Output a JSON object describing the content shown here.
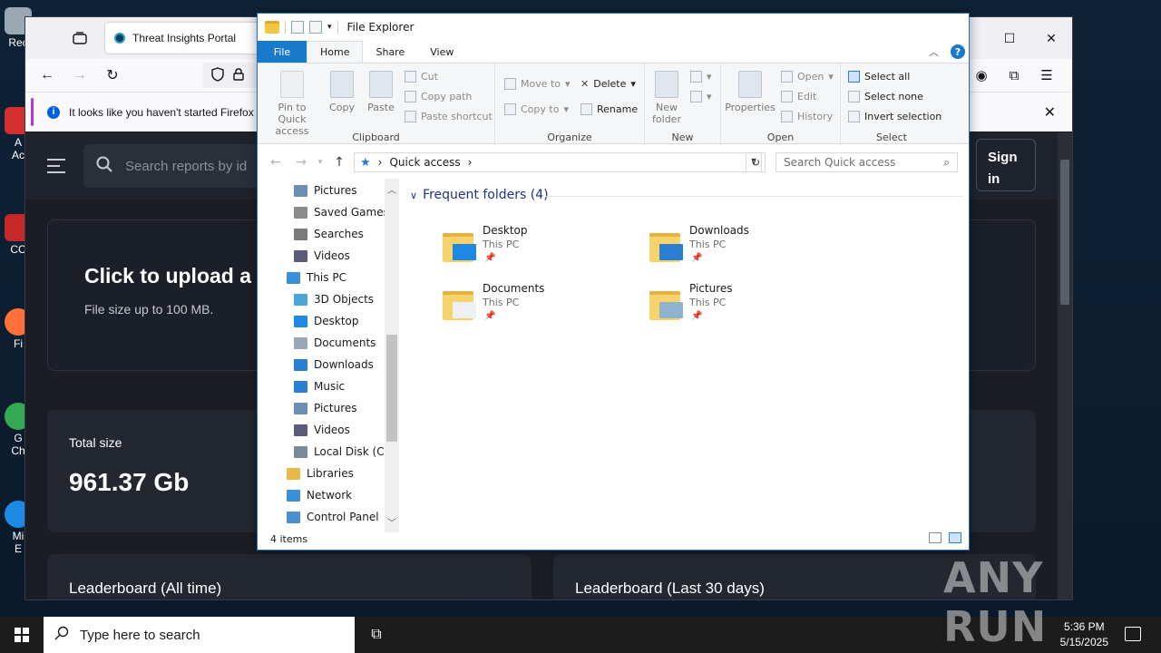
{
  "desktop": {
    "icons": [
      "Rec",
      "A\nAc",
      "CC",
      "Fi",
      "G\nCh",
      "Mi\nE"
    ]
  },
  "firefox": {
    "tab_title": "Threat Insights Portal",
    "notice_text": "It looks like you haven't started Firefox in",
    "page": {
      "search_placeholder": "Search reports by id",
      "signin_label": "Sign in",
      "upload_title": "Click to upload a",
      "upload_sub": "File size up to 100 MB.",
      "total_size_label": "Total size",
      "total_size_value": "961.37 Gb",
      "leaderboard_all": "Leaderboard (All time)",
      "leaderboard_30": "Leaderboard (Last 30 days)"
    }
  },
  "explorer": {
    "title": "File Explorer",
    "ribbon_tabs": [
      "File",
      "Home",
      "Share",
      "View"
    ],
    "clipboard": {
      "group": "Clipboard",
      "pin": "Pin to Quick access",
      "copy": "Copy",
      "paste": "Paste",
      "cut": "Cut",
      "copy_path": "Copy path",
      "paste_shortcut": "Paste shortcut"
    },
    "organize": {
      "group": "Organize",
      "move_to": "Move to",
      "copy_to": "Copy to",
      "delete": "Delete",
      "rename": "Rename"
    },
    "new": {
      "group": "New",
      "new_folder": "New folder"
    },
    "open": {
      "group": "Open",
      "properties": "Properties",
      "open": "Open",
      "edit": "Edit",
      "history": "History"
    },
    "select": {
      "group": "Select",
      "select_all": "Select all",
      "select_none": "Select none",
      "invert": "Invert selection"
    },
    "address": "Quick access",
    "search_placeholder": "Search Quick access",
    "nav_items": [
      {
        "label": "Pictures",
        "color": "#6a8fb0"
      },
      {
        "label": "Saved Games",
        "color": "#8a8a8a"
      },
      {
        "label": "Searches",
        "color": "#7a7a7a"
      },
      {
        "label": "Videos",
        "color": "#5a5a7a"
      },
      {
        "label": "This PC",
        "color": "#3c8fd6"
      },
      {
        "label": "3D Objects",
        "color": "#49a7d8"
      },
      {
        "label": "Desktop",
        "color": "#1e88e5"
      },
      {
        "label": "Documents",
        "color": "#9aa7b4"
      },
      {
        "label": "Downloads",
        "color": "#2a7fd4"
      },
      {
        "label": "Music",
        "color": "#2a7fd4"
      },
      {
        "label": "Pictures",
        "color": "#6a8fb0"
      },
      {
        "label": "Videos",
        "color": "#5a5a7a"
      },
      {
        "label": "Local Disk (C:)",
        "color": "#7a8a99"
      },
      {
        "label": "Libraries",
        "color": "#e8b84a"
      },
      {
        "label": "Network",
        "color": "#3c8fd6"
      },
      {
        "label": "Control Panel",
        "color": "#4a8fcf"
      }
    ],
    "frequent_header": "Frequent folders (4)",
    "folders": [
      {
        "name": "Desktop",
        "sub": "This PC",
        "overlay": "#1e88e5"
      },
      {
        "name": "Downloads",
        "sub": "This PC",
        "overlay": "#2a7fd4"
      },
      {
        "name": "Documents",
        "sub": "This PC",
        "overlay": "#eef1f4"
      },
      {
        "name": "Pictures",
        "sub": "This PC",
        "overlay": "#8fb3cf"
      }
    ],
    "status": "4 items"
  },
  "taskbar": {
    "search_placeholder": "Type here to search",
    "time": "5:36 PM",
    "date": "5/15/2025"
  },
  "watermark": "ANY RUN"
}
